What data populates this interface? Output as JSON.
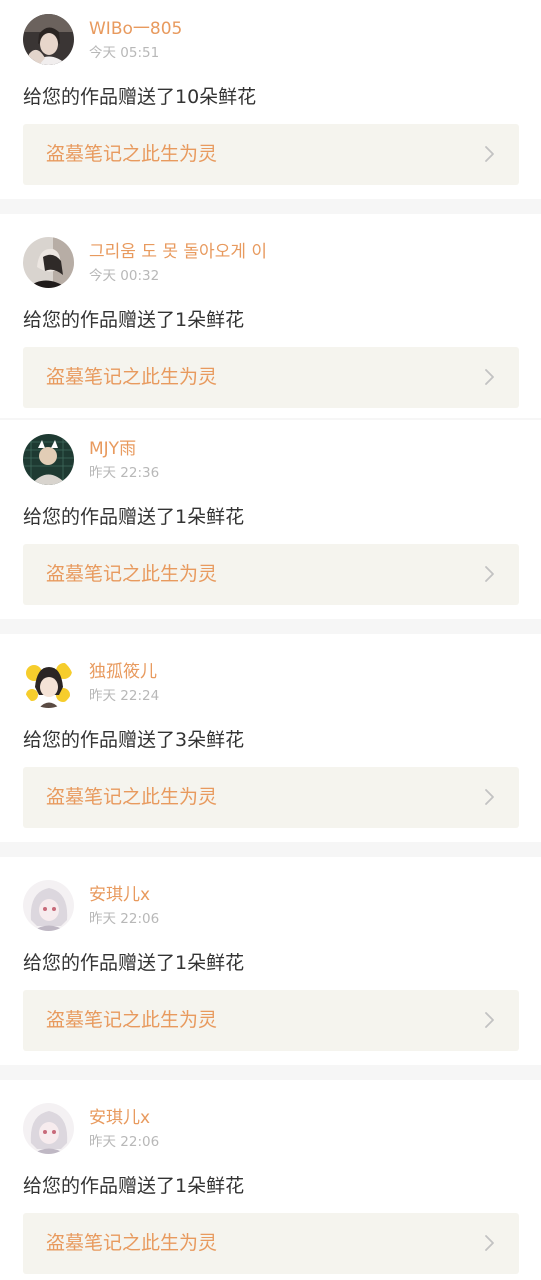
{
  "colors": {
    "accent": "#e89a5e",
    "timestamp": "#b8b8b8",
    "message": "#333333",
    "card_background": "#ffffff",
    "separator": "#f6f6f6",
    "work_box": "#f5f4ee"
  },
  "notifications": [
    {
      "username": "WIBo一805",
      "time": "今天 05:51",
      "message": "给您的作品赠送了10朵鲜花",
      "work_title": "盗墓笔记之此生为灵",
      "chevron_icon": "chevron-right-icon"
    },
    {
      "username": "그리움 도 못 돌아오게 이",
      "time": "今天 00:32",
      "message": "给您的作品赠送了1朵鲜花",
      "work_title": "盗墓笔记之此生为灵",
      "chevron_icon": "chevron-right-icon"
    },
    {
      "username": "MJY雨",
      "time": "昨天 22:36",
      "message": "给您的作品赠送了1朵鲜花",
      "work_title": "盗墓笔记之此生为灵",
      "chevron_icon": "chevron-right-icon"
    },
    {
      "username": "独孤筱儿",
      "time": "昨天 22:24",
      "message": "给您的作品赠送了3朵鲜花",
      "work_title": "盗墓笔记之此生为灵",
      "chevron_icon": "chevron-right-icon"
    },
    {
      "username": "安琪儿x",
      "time": "昨天 22:06",
      "message": "给您的作品赠送了1朵鲜花",
      "work_title": "盗墓笔记之此生为灵",
      "chevron_icon": "chevron-right-icon"
    },
    {
      "username": "安琪儿x",
      "time": "昨天 22:06",
      "message": "给您的作品赠送了1朵鲜花",
      "work_title": "盗墓笔记之此生为灵",
      "chevron_icon": "chevron-right-icon"
    }
  ]
}
